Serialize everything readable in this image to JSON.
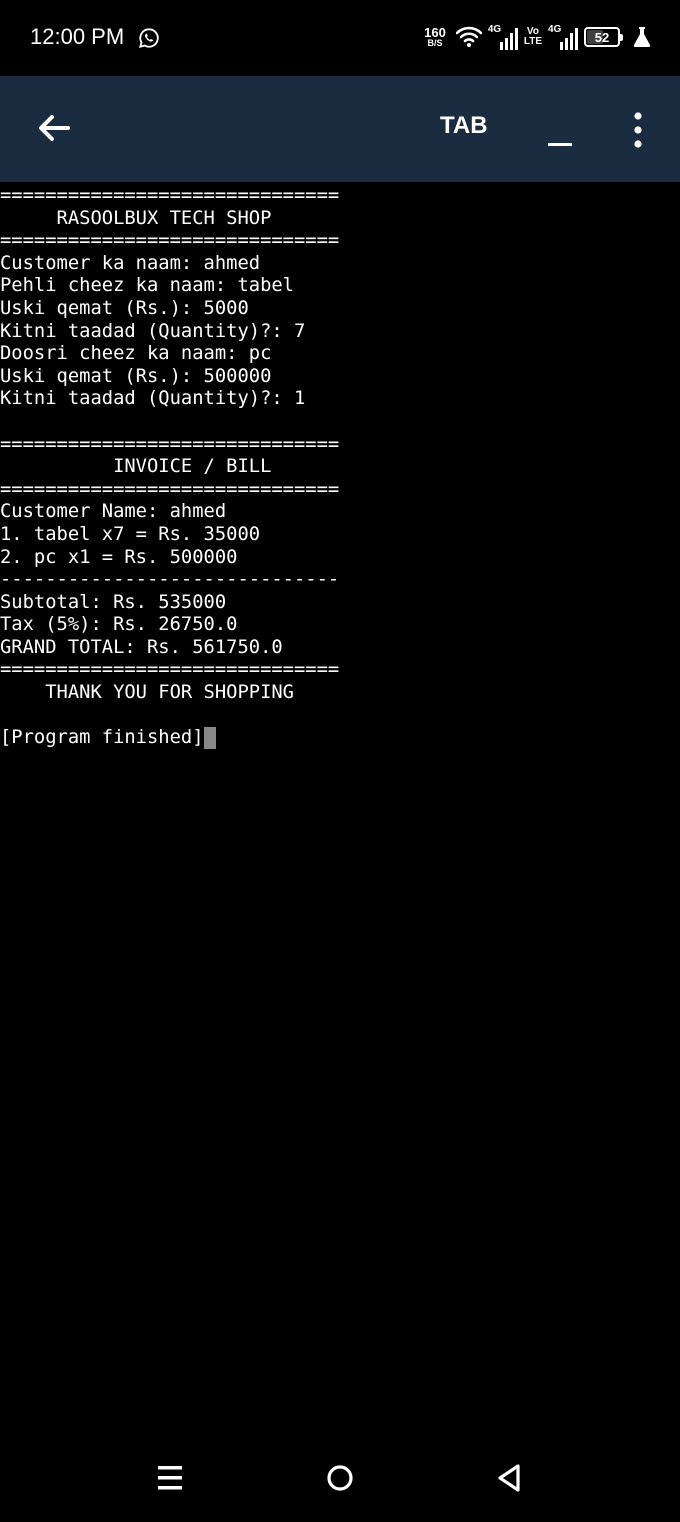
{
  "status_bar": {
    "time": "12:00 PM",
    "net_speed_value": "160",
    "net_speed_unit": "B/S",
    "sim1_tag": "4G",
    "volte_top": "Vo",
    "volte_bottom": "LTE",
    "sim2_tag": "4G",
    "battery_level": "52",
    "battery_fraction": 0.52,
    "icons": [
      "whatsapp-icon",
      "wifi-icon",
      "signal-icon",
      "battery-icon",
      "flask-icon"
    ]
  },
  "toolbar": {
    "back_icon": "arrow-left-icon",
    "tab_label": "TAB",
    "underscore_label": "_",
    "menu_icon": "more-vertical-icon"
  },
  "terminal": {
    "lines": [
      "==============================",
      "     RASOOLBUX TECH SHOP",
      "==============================",
      "Customer ka naam: ahmed",
      "Pehli cheez ka naam: tabel",
      "Uski qemat (Rs.): 5000",
      "Kitni taadad (Quantity)?: 7",
      "Doosri cheez ka naam: pc",
      "Uski qemat (Rs.): 500000",
      "Kitni taadad (Quantity)?: 1",
      "",
      "==============================",
      "          INVOICE / BILL",
      "==============================",
      "Customer Name: ahmed",
      "1. tabel x7 = Rs. 35000",
      "2. pc x1 = Rs. 500000",
      "------------------------------",
      "Subtotal: Rs. 535000",
      "Tax (5%): Rs. 26750.0",
      "GRAND TOTAL: Rs. 561750.0",
      "==============================",
      "    THANK YOU FOR SHOPPING",
      ""
    ],
    "final_line": "[Program finished]"
  },
  "nav_bar": {
    "icons": [
      "recents-menu-icon",
      "home-circle-icon",
      "back-triangle-icon"
    ]
  },
  "colors": {
    "background": "#000000",
    "toolbar": "#1b2b40",
    "text": "#ffffff",
    "cursor": "#888888"
  }
}
